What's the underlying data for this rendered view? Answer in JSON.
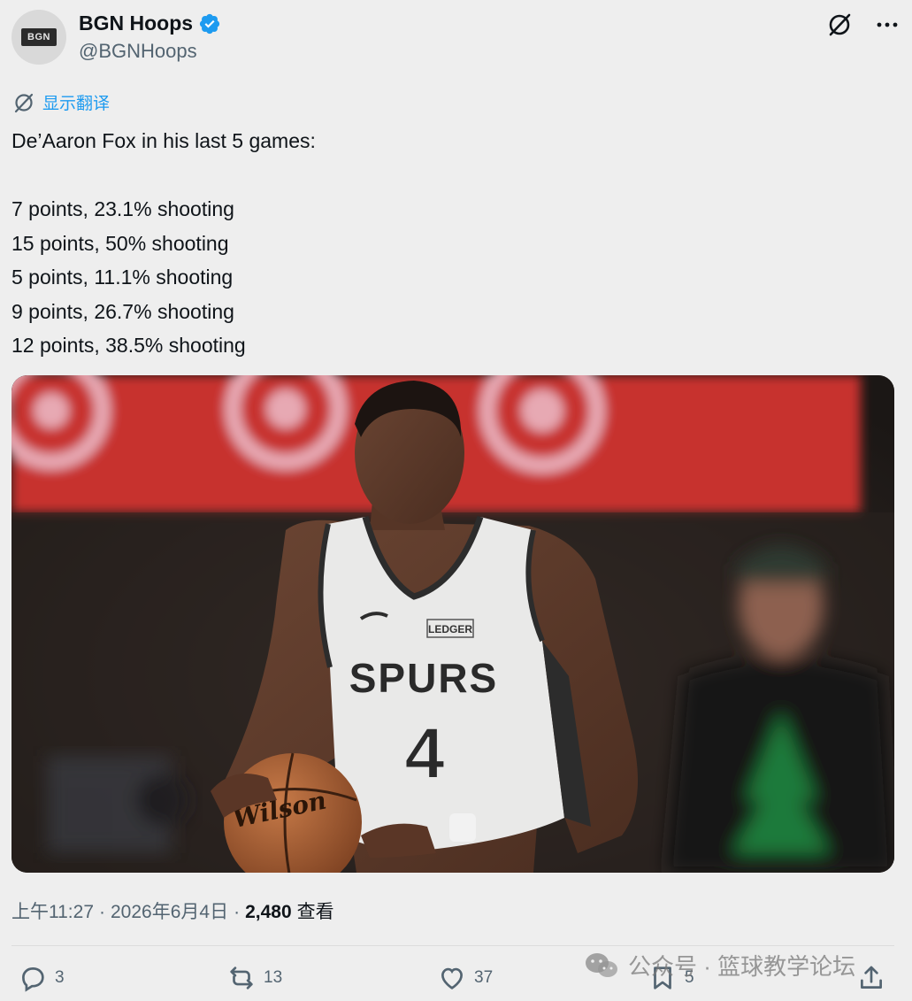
{
  "author": {
    "avatar_text": "BGN",
    "display_name": "BGN Hoops",
    "handle": "@BGNHoops",
    "verified": true
  },
  "translate_label": "显示翻译",
  "tweet": {
    "lines": [
      "De’Aaron Fox in his last 5 games:",
      "",
      "7 points, 23.1% shooting",
      "15 points, 50% shooting",
      "5 points, 11.1% shooting",
      "9 points, 26.7% shooting",
      "12 points, 38.5% shooting"
    ]
  },
  "media": {
    "jersey_brand": "LEDGER",
    "jersey_team": "SPURS",
    "jersey_number": "4",
    "ball_brand": "Wilson"
  },
  "meta": {
    "time": "上午11:27",
    "separator": "·",
    "date": "2026年6月4日",
    "views_count": "2,480",
    "views_label": "查看"
  },
  "actions": {
    "replies": "3",
    "retweets": "13",
    "likes": "37",
    "bookmarks": "5"
  },
  "watermark": "公众号 · 篮球教学论坛",
  "colors": {
    "accent": "#1d9bf0",
    "text": "#0f1419",
    "muted": "#536471",
    "background": "#eeeeee"
  },
  "icons": [
    "verified-badge-icon",
    "grok-icon",
    "more-icon",
    "translate-icon",
    "reply-icon",
    "retweet-icon",
    "like-icon",
    "bookmark-icon",
    "share-icon",
    "wechat-icon"
  ]
}
